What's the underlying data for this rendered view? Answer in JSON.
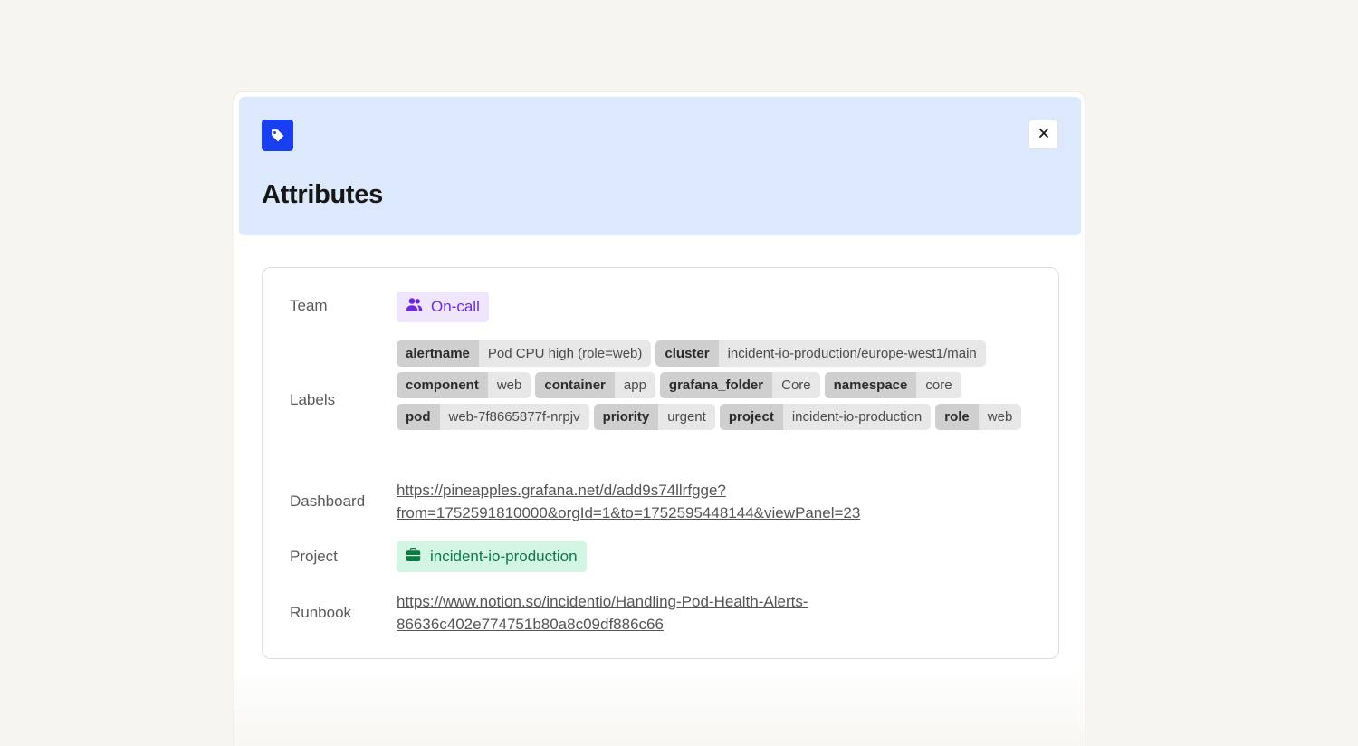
{
  "modal": {
    "title": "Attributes",
    "header_icon": "tag-icon",
    "close_icon": "close-icon",
    "accent": "#1a3ff0"
  },
  "attributes": {
    "team": {
      "label": "Team",
      "value": "On-call",
      "icon": "people-icon",
      "color": "#6d2ae0"
    },
    "labels": {
      "label": "Labels",
      "items": [
        {
          "key": "alertname",
          "value": "Pod CPU high (role=web)"
        },
        {
          "key": "cluster",
          "value": "incident-io-production/europe-west1/main"
        },
        {
          "key": "component",
          "value": "web"
        },
        {
          "key": "container",
          "value": "app"
        },
        {
          "key": "grafana_folder",
          "value": "Core"
        },
        {
          "key": "namespace",
          "value": "core"
        },
        {
          "key": "pod",
          "value": "web-7f8665877f-nrpjv"
        },
        {
          "key": "priority",
          "value": "urgent"
        },
        {
          "key": "project",
          "value": "incident-io-production"
        },
        {
          "key": "role",
          "value": "web"
        }
      ]
    },
    "dashboard": {
      "label": "Dashboard",
      "line1": "https://pineapples.grafana.net/d/add9s74llrfgge?",
      "line2": "from=1752591810000&orgId=1&to=1752595448144&viewPanel=23"
    },
    "project": {
      "label": "Project",
      "value": "incident-io-production",
      "icon": "briefcase-icon",
      "color": "#0b7a45"
    },
    "runbook": {
      "label": "Runbook",
      "line1": "https://www.notion.so/incidentio/Handling-Pod-Health-Alerts-",
      "line2": "86636c402e774751b80a8c09df886c66"
    }
  }
}
